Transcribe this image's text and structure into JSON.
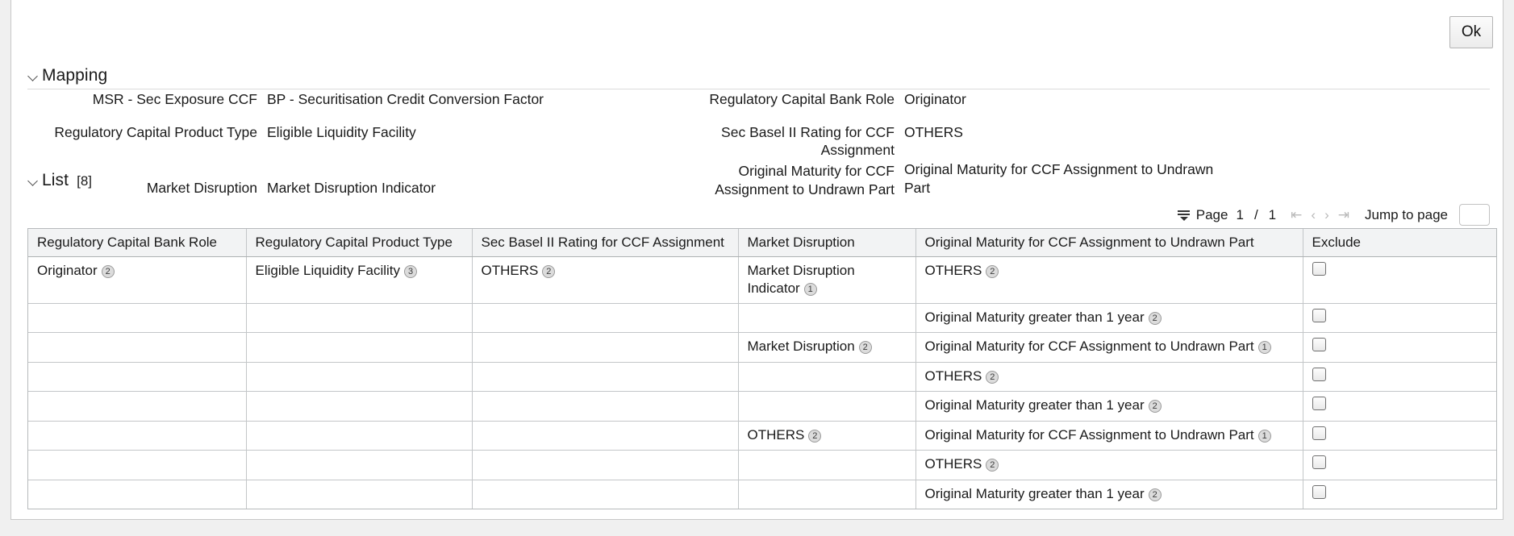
{
  "toolbar": {
    "ok_label": "Ok"
  },
  "mapping": {
    "title": "Mapping",
    "rows_left": [
      {
        "label": "MSR - Sec Exposure CCF",
        "value": "BP - Securitisation Credit Conversion Factor"
      },
      {
        "label": "Regulatory Capital Product Type",
        "value": "Eligible Liquidity Facility"
      },
      {
        "label": "Market Disruption",
        "value": "Market Disruption Indicator"
      }
    ],
    "rows_right": [
      {
        "label": "Regulatory Capital Bank Role",
        "value": "Originator"
      },
      {
        "label": "Sec Basel II Rating for CCF Assignment",
        "value": "OTHERS"
      },
      {
        "label": "Original Maturity for CCF Assignment to Undrawn Part",
        "value": "Original Maturity for CCF Assignment to Undrawn Part"
      }
    ]
  },
  "list": {
    "title": "List",
    "count": "[8]",
    "pager": {
      "menu_icon": "filter-menu-icon",
      "page_label": "Page",
      "current_page": "1",
      "separator": "/",
      "total_pages": "1",
      "first_icon": "first-page-icon",
      "prev_icon": "previous-page-icon",
      "next_icon": "next-page-icon",
      "last_icon": "last-page-icon",
      "jump_label": "Jump to page",
      "jump_value": "",
      "jump_placeholder": ""
    },
    "columns": [
      "Regulatory Capital Bank Role",
      "Regulatory Capital Product Type",
      "Sec Basel II Rating for CCF Assignment",
      "Market Disruption",
      "Original Maturity for CCF Assignment to Undrawn Part",
      "Exclude"
    ],
    "rows": [
      {
        "bank_role": "Originator",
        "bank_role_badge": "2",
        "product_type": "Eligible Liquidity Facility",
        "product_type_badge": "3",
        "rating": "OTHERS",
        "rating_badge": "2",
        "disruption": "Market Disruption Indicator",
        "disruption_badge": "1",
        "maturity": "OTHERS",
        "maturity_badge": "2",
        "exclude": false
      },
      {
        "bank_role": "",
        "bank_role_badge": "",
        "product_type": "",
        "product_type_badge": "",
        "rating": "",
        "rating_badge": "",
        "disruption": "",
        "disruption_badge": "",
        "maturity": "Original Maturity greater than 1 year",
        "maturity_badge": "2",
        "exclude": false
      },
      {
        "bank_role": "",
        "bank_role_badge": "",
        "product_type": "",
        "product_type_badge": "",
        "rating": "",
        "rating_badge": "",
        "disruption": "Market Disruption",
        "disruption_badge": "2",
        "maturity": "Original Maturity for CCF Assignment to Undrawn Part",
        "maturity_badge": "1",
        "exclude": false
      },
      {
        "bank_role": "",
        "bank_role_badge": "",
        "product_type": "",
        "product_type_badge": "",
        "rating": "",
        "rating_badge": "",
        "disruption": "",
        "disruption_badge": "",
        "maturity": "OTHERS",
        "maturity_badge": "2",
        "exclude": false
      },
      {
        "bank_role": "",
        "bank_role_badge": "",
        "product_type": "",
        "product_type_badge": "",
        "rating": "",
        "rating_badge": "",
        "disruption": "",
        "disruption_badge": "",
        "maturity": "Original Maturity greater than 1 year",
        "maturity_badge": "2",
        "exclude": false
      },
      {
        "bank_role": "",
        "bank_role_badge": "",
        "product_type": "",
        "product_type_badge": "",
        "rating": "",
        "rating_badge": "",
        "disruption": "OTHERS",
        "disruption_badge": "2",
        "maturity": "Original Maturity for CCF Assignment to Undrawn Part",
        "maturity_badge": "1",
        "exclude": false
      },
      {
        "bank_role": "",
        "bank_role_badge": "",
        "product_type": "",
        "product_type_badge": "",
        "rating": "",
        "rating_badge": "",
        "disruption": "",
        "disruption_badge": "",
        "maturity": "OTHERS",
        "maturity_badge": "2",
        "exclude": false
      },
      {
        "bank_role": "",
        "bank_role_badge": "",
        "product_type": "",
        "product_type_badge": "",
        "rating": "",
        "rating_badge": "",
        "disruption": "",
        "disruption_badge": "",
        "maturity": "Original Maturity greater than 1 year",
        "maturity_badge": "2",
        "exclude": false
      }
    ]
  },
  "colors": {
    "panel_bg": "#ffffff",
    "page_bg": "#f0f0f0",
    "header_bg": "#f2f3f4",
    "grid_line": "#c3c6c8",
    "text": "#1a1a1a",
    "nav_disabled": "#b9b9b9",
    "badge_bg": "#dcdcdc"
  }
}
